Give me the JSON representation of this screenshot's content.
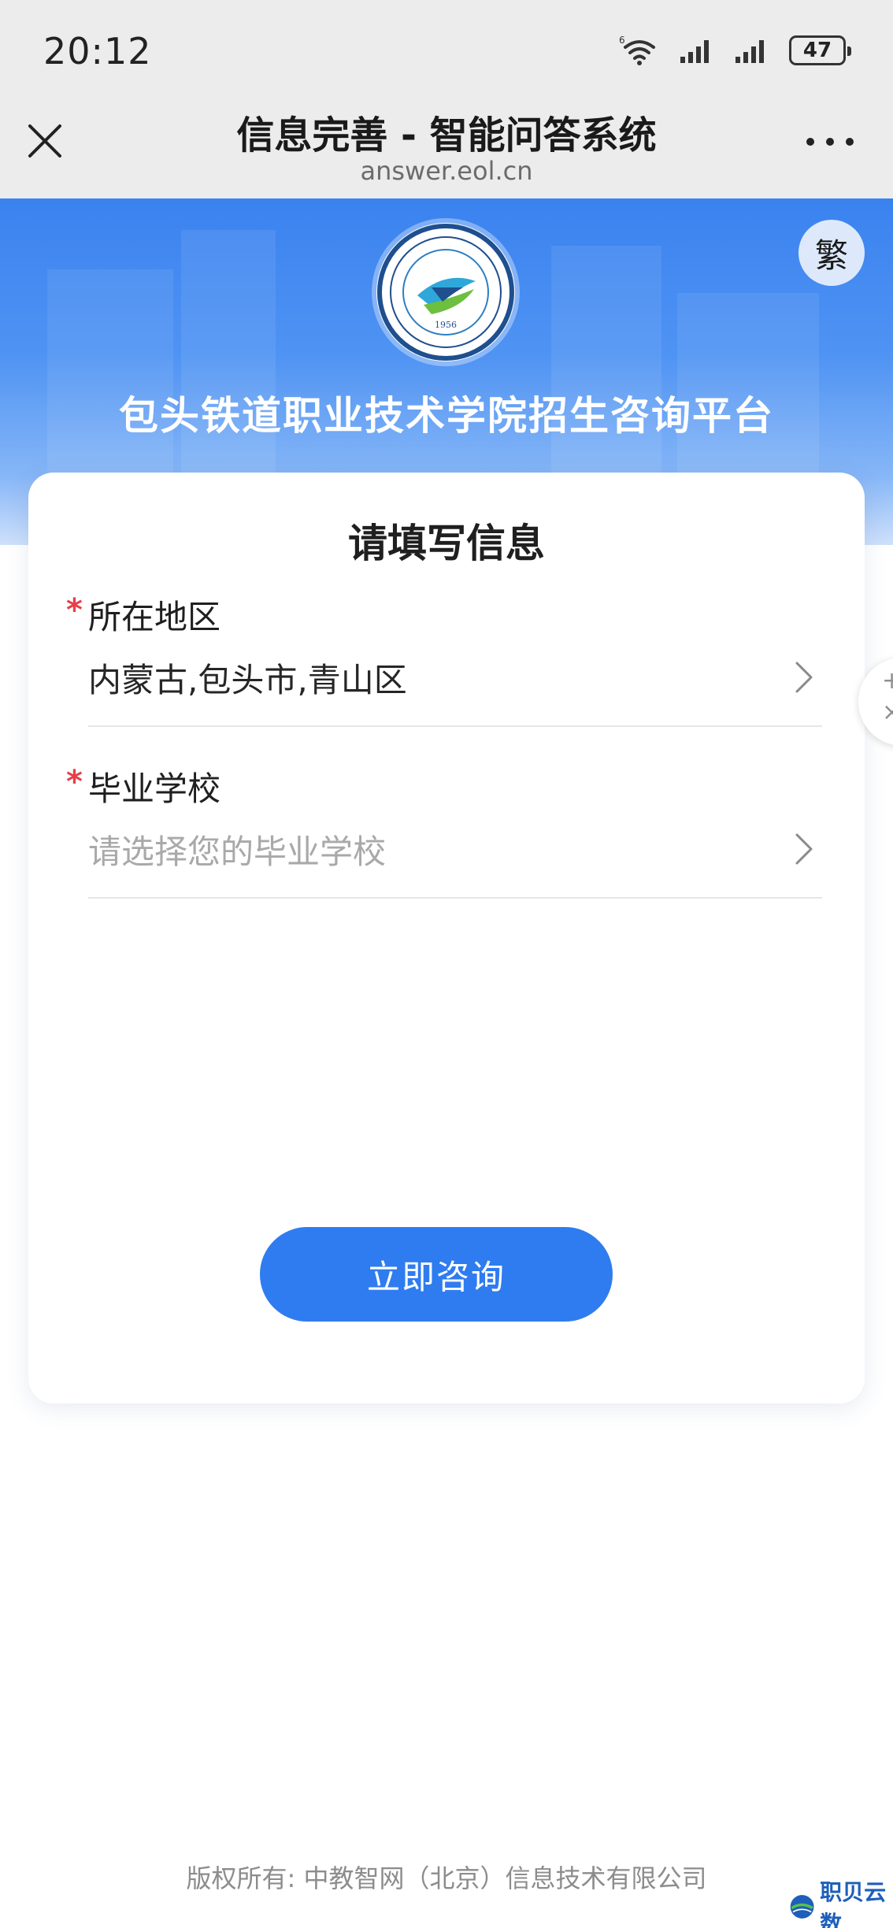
{
  "status_bar": {
    "time": "20:12",
    "battery": "47",
    "icons": [
      "wifi-6-icon",
      "signal-icon",
      "signal-icon",
      "battery-icon"
    ]
  },
  "title_bar": {
    "title": "信息完善 - 智能问答系统",
    "url": "answer.eol.cn",
    "close_icon": "close-icon",
    "more_icon": "more-icon"
  },
  "hero": {
    "logo_year": "1956",
    "traditional_toggle": "繁",
    "platform_title": "包头铁道职业技术学院招生咨询平台"
  },
  "form": {
    "title": "请填写信息",
    "required_mark": "*",
    "region": {
      "label": "所在地区",
      "value": "内蒙古,包头市,青山区"
    },
    "school": {
      "label": "毕业学校",
      "placeholder": "请选择您的毕业学校"
    },
    "submit_label": "立即咨询"
  },
  "side_tab": {
    "plus": "+",
    "close": "×"
  },
  "footer": {
    "copyright": "版权所有: 中教智网（北京）信息技术有限公司"
  },
  "watermark": {
    "text": "职贝云数"
  },
  "colors": {
    "primary": "#2f7cf0",
    "hero_top": "#3a82ef",
    "required": "#e5404a",
    "placeholder": "#a9a9a9"
  }
}
